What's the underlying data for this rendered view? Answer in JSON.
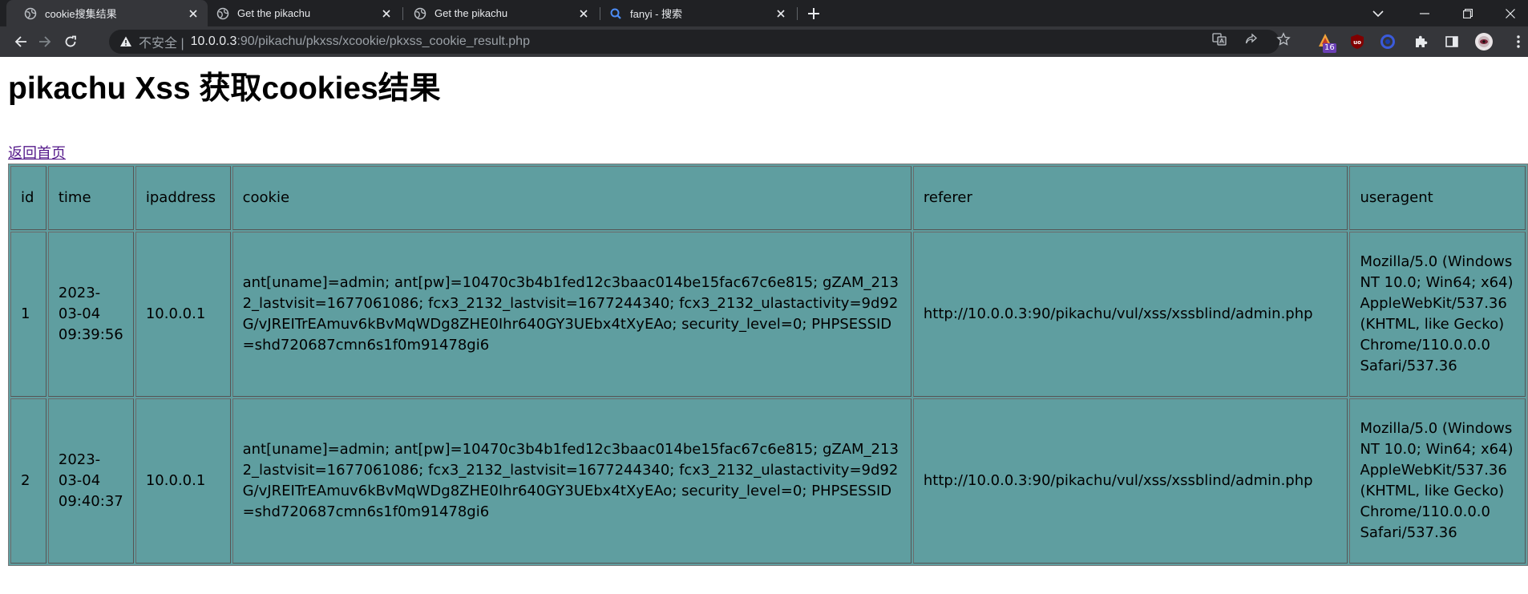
{
  "browser": {
    "tabs": [
      {
        "title": "cookie搜集结果",
        "active": true,
        "icon": "globe-icon"
      },
      {
        "title": "Get the pikachu",
        "active": false,
        "icon": "globe-icon"
      },
      {
        "title": "Get the pikachu",
        "active": false,
        "icon": "globe-icon"
      },
      {
        "title": "fanyi - 搜索",
        "active": false,
        "icon": "search-icon"
      }
    ],
    "address": {
      "insecure_label": "不安全 |",
      "host": "10.0.0.3",
      "path": ":90/pikachu/pkxss/xcookie/pkxss_cookie_result.php"
    },
    "extension_badge": "16",
    "colors": {
      "tabbar": "#202124",
      "toolbar": "#35363a",
      "omnibox": "#202124",
      "table_bg": "#5f9ea0",
      "link": "#551a8b"
    }
  },
  "page": {
    "title": "pikachu Xss 获取cookies结果",
    "home_link": "返回首页",
    "table": {
      "headers": [
        "id",
        "time",
        "ipaddress",
        "cookie",
        "referer",
        "useragent"
      ],
      "rows": [
        {
          "id": "1",
          "time": "2023-03-04 09:39:56",
          "ipaddress": "10.0.0.1",
          "cookie": "ant[uname]=admin; ant[pw]=10470c3b4b1fed12c3baac014be15fac67c6e815; gZAM_2132_lastvisit=1677061086; fcx3_2132_lastvisit=1677244340; fcx3_2132_ulastactivity=9d92G/vJREITrEAmuv6kBvMqWDg8ZHE0Ihr640GY3UEbx4tXyEAo; security_level=0; PHPSESSID=shd720687cmn6s1f0m91478gi6",
          "referer": "http://10.0.0.3:90/pikachu/vul/xss/xssblind/admin.php",
          "useragent": "Mozilla/5.0 (Windows NT 10.0; Win64; x64) AppleWebKit/537.36 (KHTML, like Gecko) Chrome/110.0.0.0 Safari/537.36"
        },
        {
          "id": "2",
          "time": "2023-03-04 09:40:37",
          "ipaddress": "10.0.0.1",
          "cookie": "ant[uname]=admin; ant[pw]=10470c3b4b1fed12c3baac014be15fac67c6e815; gZAM_2132_lastvisit=1677061086; fcx3_2132_lastvisit=1677244340; fcx3_2132_ulastactivity=9d92G/vJREITrEAmuv6kBvMqWDg8ZHE0Ihr640GY3UEbx4tXyEAo; security_level=0; PHPSESSID=shd720687cmn6s1f0m91478gi6",
          "referer": "http://10.0.0.3:90/pikachu/vul/xss/xssblind/admin.php",
          "useragent": "Mozilla/5.0 (Windows NT 10.0; Win64; x64) AppleWebKit/537.36 (KHTML, like Gecko) Chrome/110.0.0.0 Safari/537.36"
        }
      ]
    }
  }
}
